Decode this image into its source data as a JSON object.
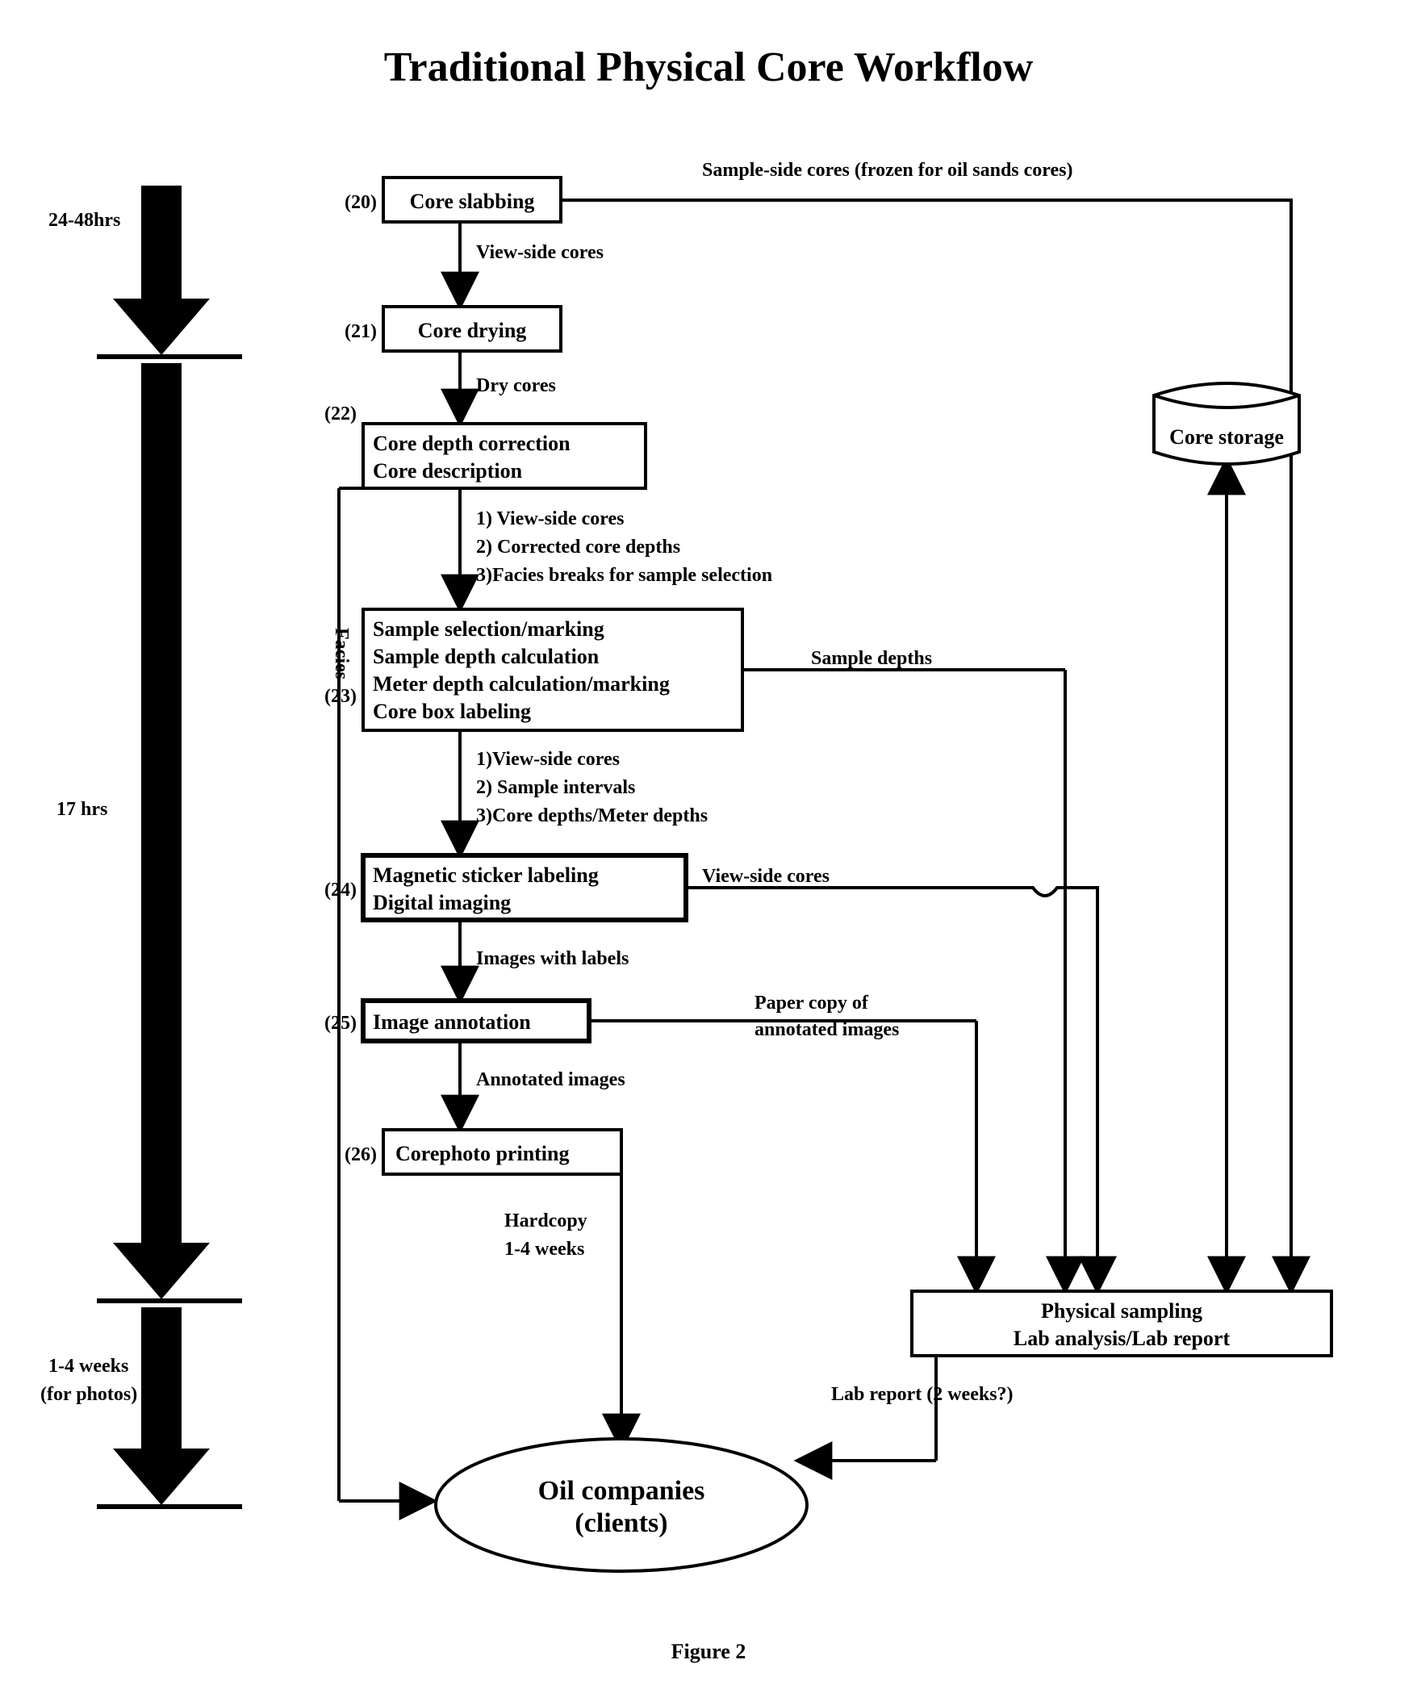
{
  "title": "Traditional Physical Core Workflow",
  "figure_label": "Figure 2",
  "timeline": {
    "phase1": "24-48hrs",
    "phase2": "17 hrs",
    "phase3a": "1-4 weeks",
    "phase3b": "(for photos)"
  },
  "vertical_label": "Facies",
  "nodes": {
    "n20": {
      "ref": "(20)",
      "line1": "Core slabbing"
    },
    "n21": {
      "ref": "(21)",
      "line1": "Core drying"
    },
    "n22": {
      "ref": "(22)",
      "line1": "Core depth correction",
      "line2": "Core description"
    },
    "n23": {
      "ref": "(23)",
      "line1": "Sample selection/marking",
      "line2": "Sample depth calculation",
      "line3": "Meter depth calculation/marking",
      "line4": "Core box labeling"
    },
    "n24": {
      "ref": "(24)",
      "line1": "Magnetic sticker labeling",
      "line2": "Digital imaging"
    },
    "n25": {
      "ref": "(25)",
      "line1": "Image annotation"
    },
    "n26": {
      "ref": "(26)",
      "line1": "Corephoto printing"
    },
    "storage": "Core storage",
    "lab": {
      "line1": "Physical sampling",
      "line2": "Lab analysis/Lab report"
    },
    "oval": {
      "line1": "Oil companies",
      "line2": "(clients)"
    }
  },
  "edge_labels": {
    "top_right": "Sample-side cores (frozen for oil sands cores)",
    "e20_21": "View-side cores",
    "e21_22": "Dry cores",
    "e22_23_1": "1) View-side cores",
    "e22_23_2": "2) Corrected core depths",
    "e22_23_3": "3)Facies breaks for sample selection",
    "e23_24_1": "1)View-side cores",
    "e23_24_2": "2) Sample intervals",
    "e23_24_3": "3)Core depths/Meter depths",
    "e23_right": "Sample depths",
    "e24_right": "View-side cores",
    "e24_25": "Images with labels",
    "e25_right_1": "Paper copy of",
    "e25_right_2": "annotated images",
    "e25_26": "Annotated images",
    "e26_oval_1": "Hardcopy",
    "e26_oval_2": "1-4 weeks",
    "lab_oval": "Lab report (2 weeks?)"
  }
}
